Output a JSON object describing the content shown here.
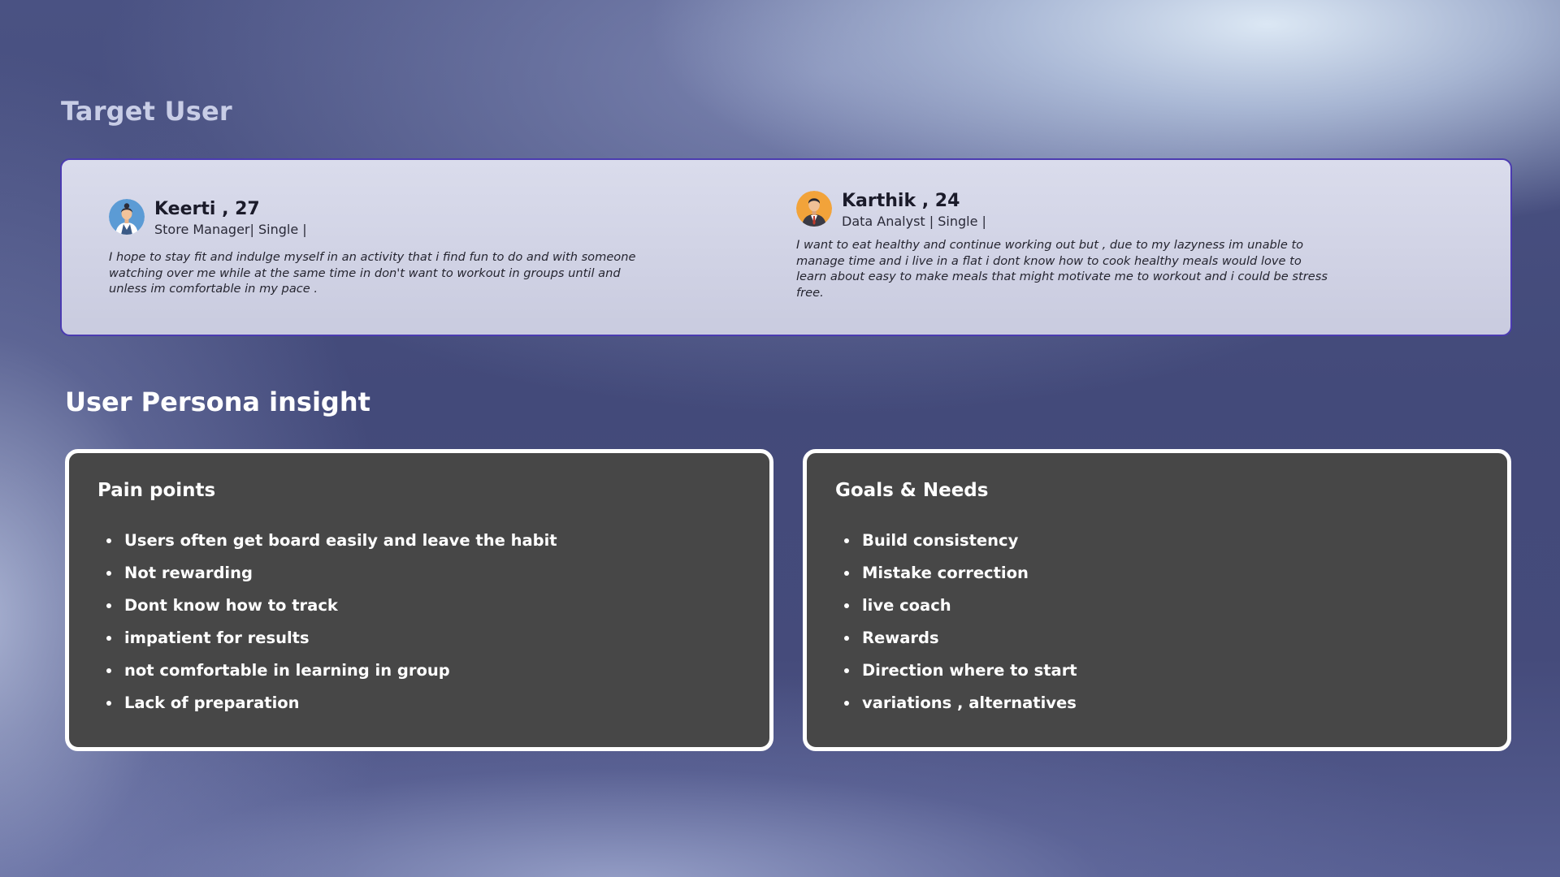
{
  "page": {
    "target_title": "Target User",
    "insight_title": "User Persona insight"
  },
  "personas": [
    {
      "name": "Keerti , 27",
      "role": "Store Manager| Single |",
      "quote": "I hope to stay fit and indulge myself in an activity that i find fun to do and with someone watching over me while at the same time in don't want to workout in groups until and unless im comfortable in my pace .",
      "avatar_icon": "female-avatar-icon"
    },
    {
      "name": "Karthik , 24",
      "role": "Data Analyst | Single |",
      "quote": "I want to eat healthy and continue working out but , due to my lazyness im unable to manage time and i live in a flat i dont know how to cook healthy meals would love to learn about easy to make meals that might motivate me to workout and i could be stress free.",
      "avatar_icon": "male-avatar-icon"
    }
  ],
  "pain_points": {
    "title": "Pain points",
    "items": [
      "Users often get board easily and leave the habit",
      "Not rewarding",
      "Dont know how to track",
      "impatient for results",
      "not comfortable in learning in group",
      "Lack of preparation"
    ]
  },
  "goals": {
    "title": "Goals & Needs",
    "items": [
      "Build consistency",
      "Mistake correction",
      "live coach",
      "Rewards",
      "Direction where to start",
      "variations , alternatives"
    ]
  },
  "colors": {
    "card_border": "#4b3bb0",
    "insight_bg": "#474747",
    "accent_female": "#5b9bd5",
    "accent_male": "#f2a33a"
  }
}
